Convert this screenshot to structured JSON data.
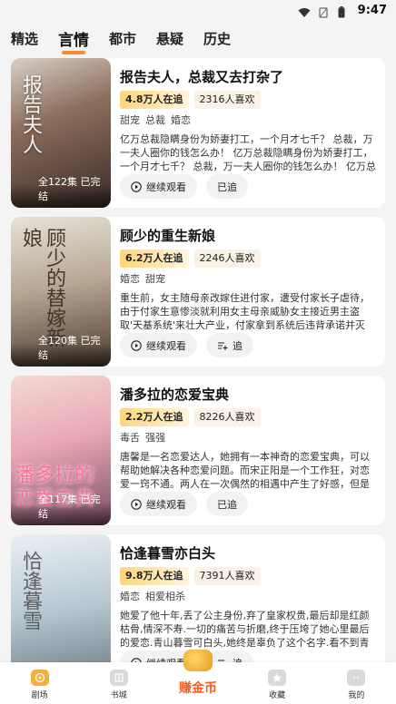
{
  "status": {
    "time": "9:47"
  },
  "tabs": [
    {
      "label": "精选",
      "active": false
    },
    {
      "label": "言情",
      "active": true
    },
    {
      "label": "都市",
      "active": false
    },
    {
      "label": "悬疑",
      "active": false
    },
    {
      "label": "历史",
      "active": false
    }
  ],
  "dramas": [
    {
      "title": "报告夫人，总裁又去打杂了",
      "cover_text": "报告夫人",
      "episodes": "全122集 已完结",
      "watching": "4.8万人在追",
      "likes": "2316人喜欢",
      "tags": [
        "甜宠",
        "总裁",
        "婚恋"
      ],
      "desc": "亿万总裁隐瞒身份为娇妻打工，一个月才七千？ 总裁，万一夫人圈你的钱怎么办！ 亿万总裁隐瞒身份为娇妻打工，一个月才七千？ 总裁，万一夫人圈你的钱怎么办！ 亿万总裁隐瞒身份为娇...",
      "continue_label": "继续观看",
      "follow_label": "已追"
    },
    {
      "title": "顾少的重生新娘",
      "cover_text": "顾少的替嫁新娘",
      "episodes": "全120集 已完结",
      "watching": "6.2万人在追",
      "likes": "2246人喜欢",
      "tags": [
        "婚恋",
        "甜宠"
      ],
      "desc": "重生前，女主随母亲改嫁住进付家，遭受付家长子虐待，由于付家生意惨淡就利用女主母亲威胁女主接近男主盗取'天基系统'来壮大产业，付家拿到系统后违背承诺并灭口，于是女主重生；重生后...",
      "continue_label": "继续观看",
      "follow_label": "追"
    },
    {
      "title": "潘多拉的恋爱宝典",
      "cover_text": "潘多拉的恋爱宝典",
      "episodes": "全117集 已完结",
      "watching": "2.2万人在追",
      "likes": "8226人喜欢",
      "tags": [
        "毒舌",
        "强强"
      ],
      "desc": "唐馨是一名恋爱达人，她拥有一本神奇的恋爱宝典，可以帮助她解决各种恋爱问题。而宋正阳是一个工作狂，对恋爱一窍不通。两人在一次偶然的相遇中产生了好感，但是宋正阳却因为工作忙碌...",
      "continue_label": "继续观看",
      "follow_label": "已追"
    },
    {
      "title": "恰逢暮雪亦白头",
      "cover_text": "恰逢暮雪",
      "episodes": "",
      "watching": "9.8万人在追",
      "likes": "7391人喜欢",
      "tags": [
        "婚恋",
        "相爱相杀"
      ],
      "desc": "她爱了他十年,丢了公主身份,弃了皇家权贵,最后却是红颜枯骨,情深不寿.一切的痛苦与折磨,终于压垮了她心里最后的爱恋.青山暮雪可白头,她终是辜负了这个名字.看不到青山,也到不了白头...",
      "continue_label": "继续观看",
      "follow_label": "追"
    }
  ],
  "bottom_nav": {
    "theater": "剧场",
    "bookstore": "书城",
    "earn": "赚金币",
    "favorites": "收藏",
    "mine": "我的"
  }
}
